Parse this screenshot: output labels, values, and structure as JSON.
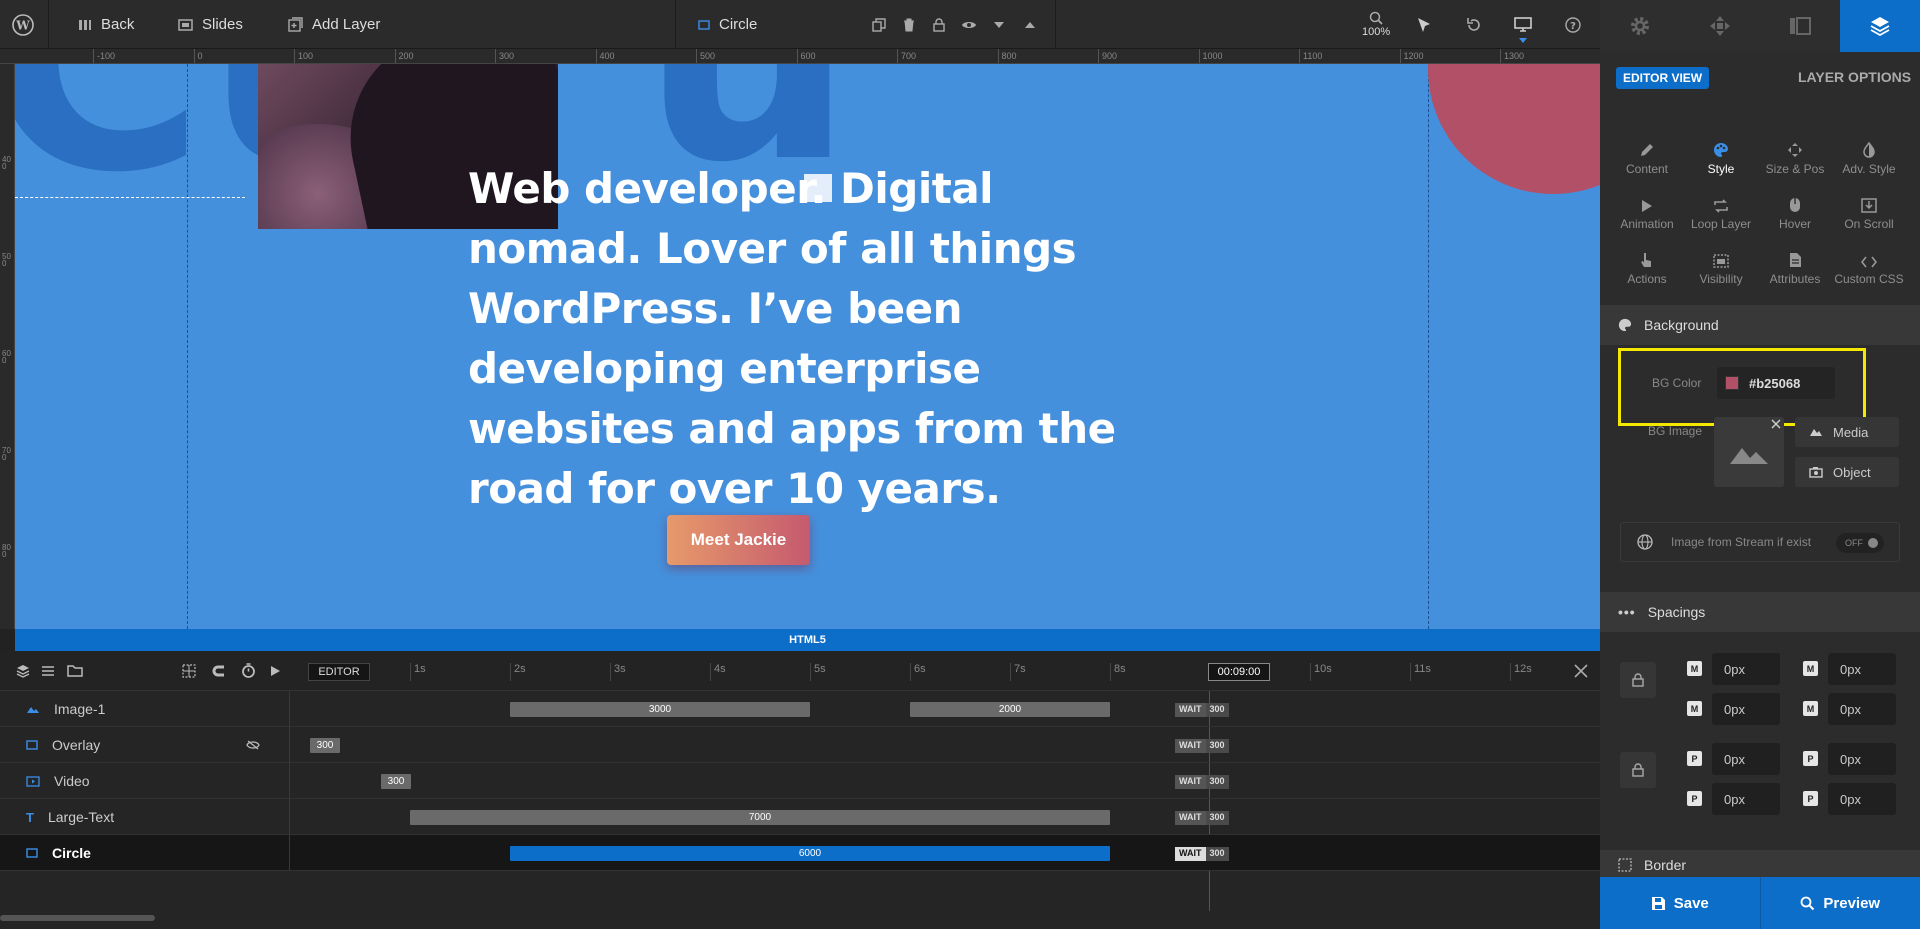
{
  "topbar": {
    "back": "Back",
    "slides": "Slides",
    "add_layer": "Add Layer",
    "layer_name": "Circle",
    "zoom": "100%"
  },
  "ruler": {
    "h_labels": [
      "-100",
      "0",
      "100",
      "200",
      "300",
      "400",
      "500",
      "600",
      "700",
      "800",
      "900",
      "1000",
      "1100",
      "1200",
      "1300",
      "14"
    ],
    "v_labels": [
      "400",
      "500",
      "600",
      "700",
      "800"
    ]
  },
  "canvas": {
    "headline": "Web developer. Digital nomad. Lover of all things WordPress. I’ve been developing enterprise websites and apps from the road for over 10 years.",
    "cta": "Meet Jackie",
    "bottom_label": "HTML5",
    "colors": {
      "background": "#4590dc",
      "circle": "#b25068"
    }
  },
  "timeline": {
    "editor_label": "EDITOR",
    "time_marker": "00:09:00",
    "seconds": [
      "1s",
      "2s",
      "3s",
      "4s",
      "5s",
      "6s",
      "7s",
      "8s",
      "9s",
      "10s",
      "11s",
      "12s"
    ],
    "wait_label": "WAIT",
    "layers": [
      {
        "name": "Image-1",
        "bars": [
          "3000",
          "2000"
        ],
        "end": "300"
      },
      {
        "name": "Overlay",
        "bars": [
          "300"
        ],
        "end": "300"
      },
      {
        "name": "Video",
        "bars": [
          "300"
        ],
        "end": "300"
      },
      {
        "name": "Large-Text",
        "bars": [
          "7000"
        ],
        "end": "300"
      },
      {
        "name": "Circle",
        "bars": [
          "6000"
        ],
        "end": "300"
      }
    ]
  },
  "panel": {
    "tabs": [
      "settings-icon",
      "move-icon",
      "slides-icon",
      "layers-icon"
    ],
    "editor_view": "EDITOR VIEW",
    "layer_options": "LAYER OPTIONS",
    "options": [
      "Content",
      "Style",
      "Size & Pos",
      "Adv. Style",
      "Animation",
      "Loop Layer",
      "Hover",
      "On Scroll",
      "Actions",
      "Visibility",
      "Attributes",
      "Custom CSS"
    ],
    "background": {
      "title": "Background",
      "bg_color_label": "BG Color",
      "bg_color_value": "#b25068",
      "bg_image_label": "BG Image",
      "media": "Media",
      "object": "Object",
      "stream_label": "Image from Stream if exist",
      "stream_toggle": "OFF"
    },
    "spacings": {
      "title": "Spacings",
      "values": [
        "0px",
        "0px",
        "0px",
        "0px",
        "0px",
        "0px",
        "0px",
        "0px"
      ]
    },
    "border_title": "Border",
    "save": "Save",
    "preview": "Preview"
  }
}
